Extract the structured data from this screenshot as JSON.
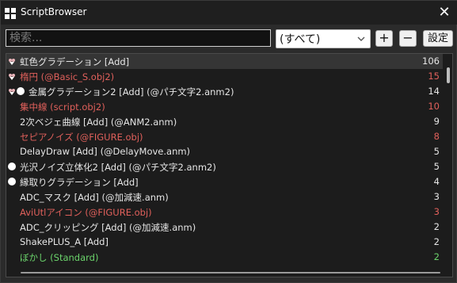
{
  "window": {
    "title": "ScriptBrowser"
  },
  "toolbar": {
    "search_placeholder": "検索...",
    "category_value": "(すべて)",
    "plus_label": "+",
    "minus_label": "−",
    "settings_label": "設定"
  },
  "colors": {
    "white_text": "#e6e6e6",
    "red_text": "#e0605b",
    "green_text": "#6bd36b",
    "pin_icon": "#e8b3b8"
  },
  "rows": [
    {
      "name": "虹色グラデーション [Add]",
      "count": "106",
      "color": "white",
      "icons": [
        "pin-icon"
      ],
      "indent": 1
    },
    {
      "name": "楕円 (@Basic_S.obj2)",
      "count": "15",
      "color": "red",
      "icons": [
        "pin-icon"
      ],
      "indent": 1
    },
    {
      "name": "金属グラデーション2 [Add] (@パチ文字2.anm2)",
      "count": "14",
      "color": "white",
      "icons": [
        "pin-icon",
        "circle-icon"
      ],
      "indent": 2
    },
    {
      "name": "集中線 (script.obj2)",
      "count": "10",
      "color": "red",
      "icons": [],
      "indent": 1
    },
    {
      "name": "2次ベジェ曲線 [Add] (@ANM2.anm)",
      "count": "9",
      "color": "white",
      "icons": [],
      "indent": 1
    },
    {
      "name": "セピアノイズ (@FIGURE.obj)",
      "count": "8",
      "color": "red",
      "icons": [],
      "indent": 1
    },
    {
      "name": "DelayDraw [Add] (@DelayMove.anm)",
      "count": "5",
      "color": "white",
      "icons": [],
      "indent": 1
    },
    {
      "name": "光沢ノイズ立体化2 [Add] (@パチ文字2.anm2)",
      "count": "5",
      "color": "white",
      "icons": [
        "circle-icon"
      ],
      "indent": 1
    },
    {
      "name": "縁取りグラデーション [Add]",
      "count": "4",
      "color": "white",
      "icons": [
        "circle-icon"
      ],
      "indent": 1
    },
    {
      "name": "ADC_マスク [Add] (@加減速.anm)",
      "count": "3",
      "color": "white",
      "icons": [],
      "indent": 1
    },
    {
      "name": "AviUtlアイコン (@FIGURE.obj)",
      "count": "3",
      "color": "red",
      "icons": [],
      "indent": 1
    },
    {
      "name": "ADC_クリッピング [Add] (@加減速.anm)",
      "count": "2",
      "color": "white",
      "icons": [],
      "indent": 1
    },
    {
      "name": "ShakePLUS_A [Add]",
      "count": "2",
      "color": "white",
      "icons": [],
      "indent": 1
    },
    {
      "name": "ぼかし (Standard)",
      "count": "2",
      "color": "green",
      "icons": [],
      "indent": 1
    }
  ]
}
